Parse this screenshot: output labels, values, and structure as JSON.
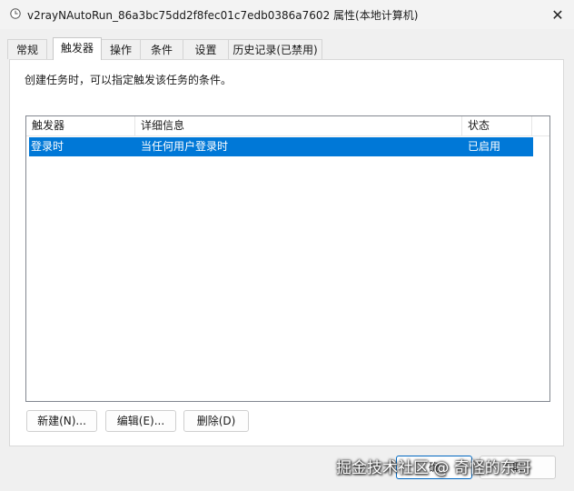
{
  "window": {
    "title": "v2rayNAutoRun_86a3bc75dd2f8fec01c7edb0386a7602 属性(本地计算机)",
    "close_glyph": "✕"
  },
  "tabs": [
    {
      "label": "常规"
    },
    {
      "label": "触发器"
    },
    {
      "label": "操作"
    },
    {
      "label": "条件"
    },
    {
      "label": "设置"
    },
    {
      "label": "历史记录(已禁用)"
    }
  ],
  "active_tab": "触发器",
  "panel": {
    "description": "创建任务时，可以指定触发该任务的条件。"
  },
  "triggers_list": {
    "columns": [
      "触发器",
      "详细信息",
      "状态"
    ],
    "rows": [
      {
        "trigger": "登录时",
        "details": "当任何用户登录时",
        "status": "已启用",
        "selected": true
      }
    ]
  },
  "buttons": {
    "new": "新建(N)...",
    "edit": "编辑(E)...",
    "delete": "删除(D)"
  },
  "footer": {
    "ok_partial": "确",
    "cancel_partial": "取"
  },
  "watermark": "掘金技术社区 @ 奇怪的东哥",
  "colors": {
    "selection": "#0078d7",
    "accent_border": "#0067c0"
  }
}
